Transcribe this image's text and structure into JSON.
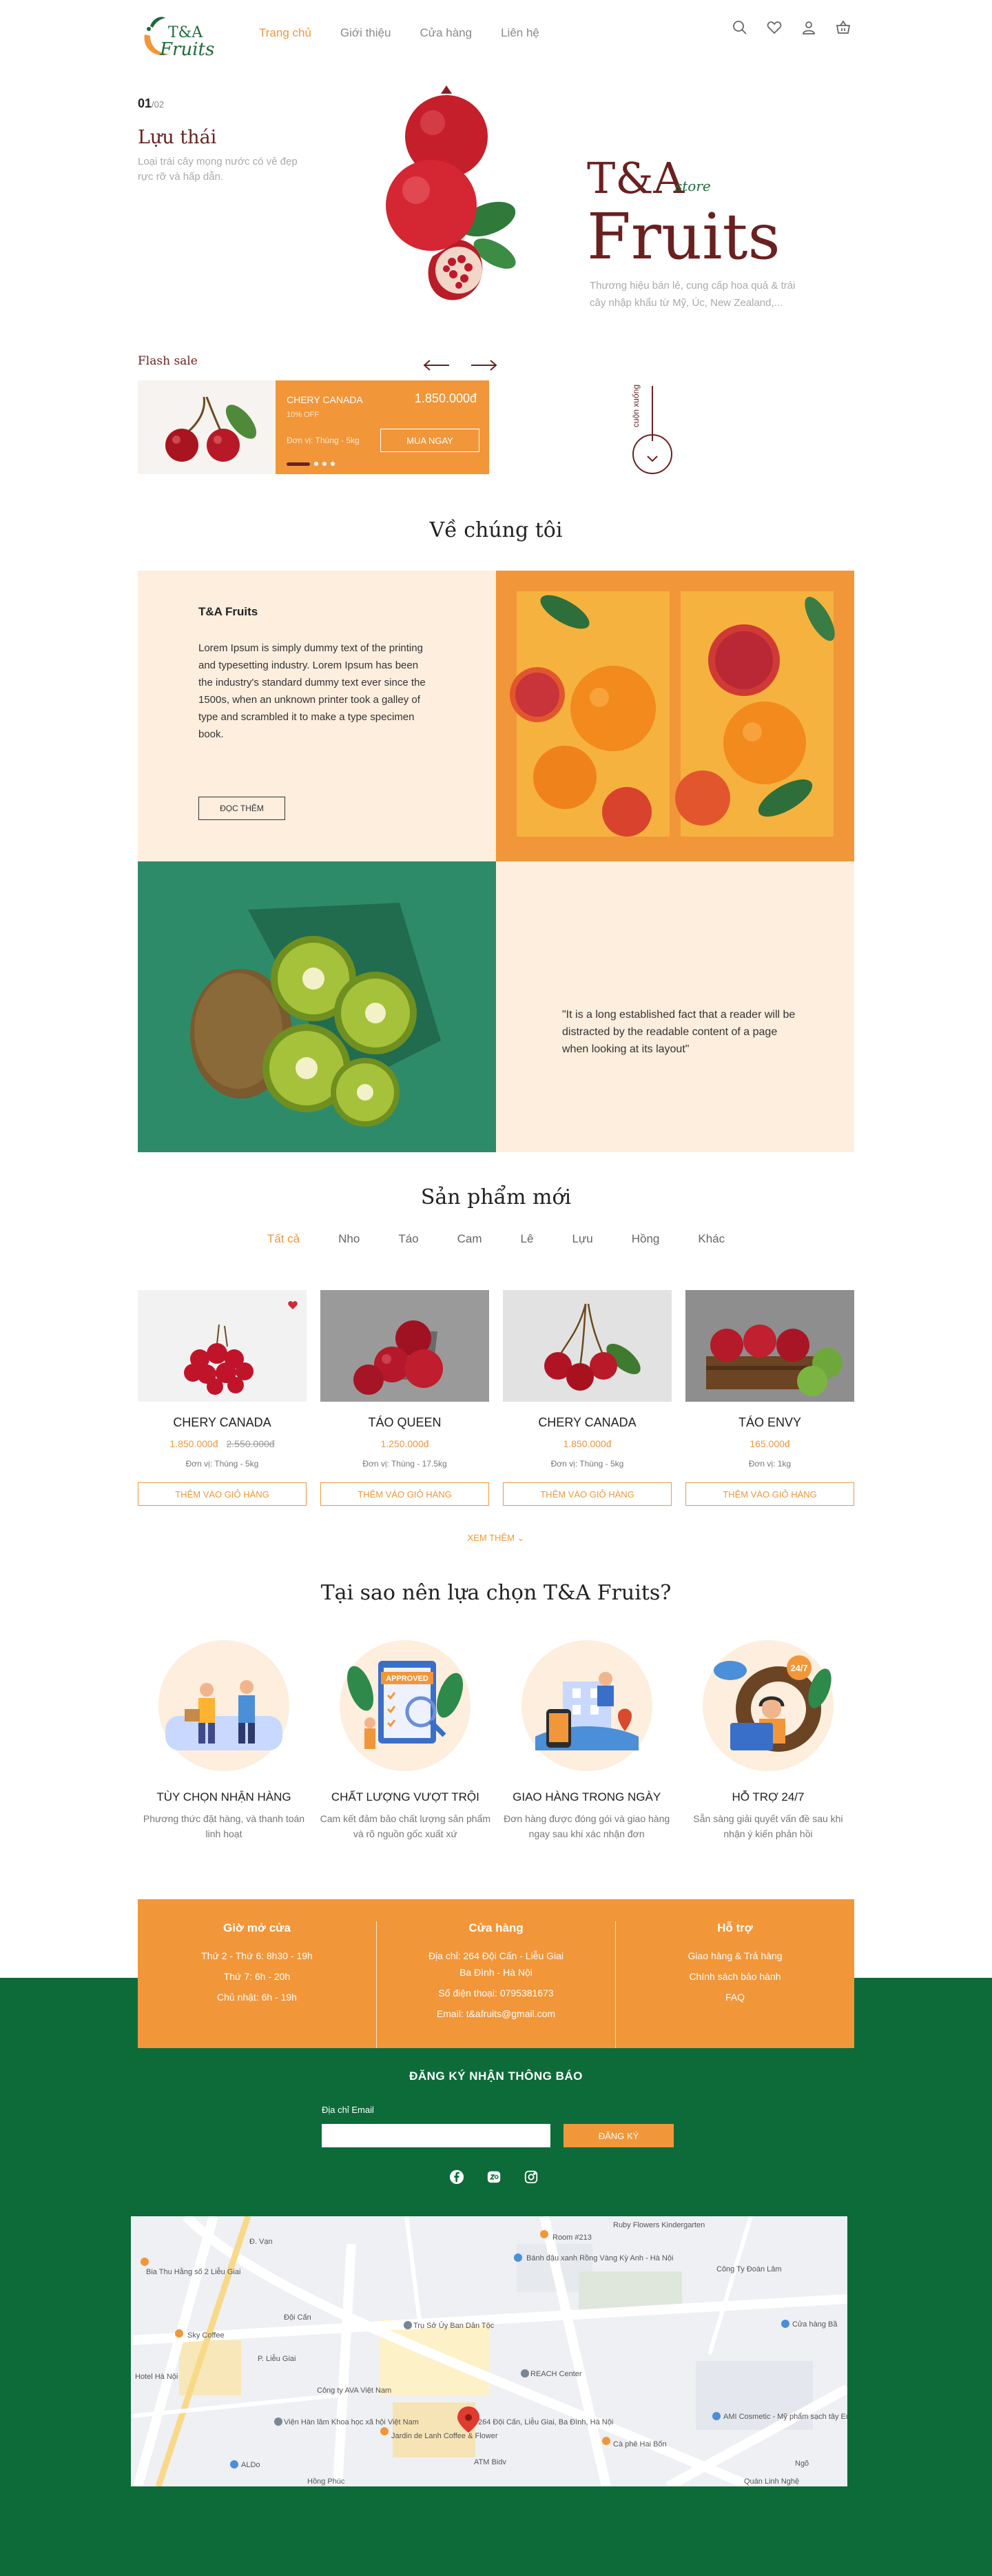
{
  "header": {
    "logo_text_1": "T&A",
    "logo_text_2": "Fruits",
    "nav": [
      "Trang chủ",
      "Giới thiệu",
      "Cửa hàng",
      "Liên hệ"
    ]
  },
  "hero": {
    "slide_current": "01",
    "slide_total": "/02",
    "name": "Lựu thái",
    "desc": "Loại trái cây mọng nước có vẻ đẹp rực rỡ và hấp dẫn.",
    "brand_top": "T&A",
    "brand_store": "store",
    "brand_main": "Fruits",
    "brand_desc": "Thương hiệu bán lẻ, cung cấp hoa quả & trái cây nhập khẩu từ Mỹ, Úc, New Zealand,..."
  },
  "flash": {
    "title": "Flash sale",
    "product": "CHERY CANADA",
    "price": "1.850.000đ",
    "off": "10% OFF",
    "unit": "Đơn vị: Thùng - 5kg",
    "button": "MUA NGAY",
    "scroll": "cuộn xuống"
  },
  "about": {
    "title": "Về chúng tôi",
    "heading": "T&A Fruits",
    "text": "Lorem Ipsum is simply dummy text of the printing and typesetting industry. Lorem Ipsum has been the industry's standard dummy text ever since the 1500s, when an unknown printer took a galley of type and scrambled it to make a type specimen book.",
    "button": "ĐỌC THÊM",
    "quote": "\"It is a long established fact that a reader will be distracted by the readable content of a page when looking at its layout\""
  },
  "products": {
    "title": "Sản phẩm mới",
    "tabs": [
      "Tất cả",
      "Nho",
      "Táo",
      "Cam",
      "Lê",
      "Lựu",
      "Hồng",
      "Khác"
    ],
    "items": [
      {
        "name": "CHERY CANADA",
        "price": "1.850.000đ",
        "old": "2.550.000đ",
        "unit": "Đơn vị: Thùng - 5kg",
        "button": "THÊM VÀO GIỎ HÀNG"
      },
      {
        "name": "TÁO QUEEN",
        "price": "1.250.000đ",
        "old": "",
        "unit": "Đơn vị: Thùng - 17.5kg",
        "button": "THÊM VÀO GIỎ HÀNG"
      },
      {
        "name": "CHERY CANADA",
        "price": "1.850.000đ",
        "old": "",
        "unit": "Đơn vị: Thùng - 5kg",
        "button": "THÊM VÀO GIỎ HÀNG"
      },
      {
        "name": "TÁO ENVY",
        "price": "165.000đ",
        "old": "",
        "unit": "Đơn vị: 1kg",
        "button": "THÊM VÀO GIỎ HÀNG"
      }
    ],
    "more": "XEM THÊM"
  },
  "why": {
    "title": "Tại sao nên lựa chọn T&A Fruits?",
    "items": [
      {
        "title": "TÙY CHỌN NHẬN HÀNG",
        "desc": "Phương thức đặt hàng, và thanh toán linh hoạt"
      },
      {
        "title": "CHẤT LƯỢNG VƯỢT TRỘI",
        "desc": "Cam kết đảm bảo chất lượng sản phẩm và rõ nguồn gốc xuất xứ"
      },
      {
        "title": "GIAO HÀNG TRONG NGÀY",
        "desc": "Đơn hàng được đóng gói và giao hàng ngay sau khi xác nhận đơn"
      },
      {
        "title": "HỖ TRỢ 24/7",
        "desc": "Sẵn sàng giải quyết vấn đề sau khi nhận ý kiến phản hồi"
      }
    ],
    "badge_approved": "APPROVED",
    "badge_247": "24/7"
  },
  "footer": {
    "hours_title": "Giờ mở cửa",
    "hours": [
      "Thứ 2 - Thứ 6: 8h30 - 19h",
      "Thứ 7: 6h - 20h",
      "Chủ nhật: 6h - 19h"
    ],
    "store_title": "Cửa hàng",
    "store": [
      "Địa chỉ: 264 Đội Cấn - Liễu Giai",
      "Ba Đình - Hà Nội",
      "Số điện thoại: 0795381673",
      "Email: t&afruits@gmail.com"
    ],
    "support_title": "Hỗ trợ",
    "support": [
      "Giao hàng & Trả hàng",
      "Chính sách bảo hành",
      "FAQ"
    ],
    "subscribe_title": "ĐĂNG KÝ NHẬN THÔNG BÁO",
    "email_label": "Địa chỉ Email",
    "email_placeholder": "",
    "subscribe_button": "ĐĂNG KÝ"
  },
  "map": {
    "labels": [
      "Ruby Flowers Kindergarten",
      "Room #213",
      "Bánh đậu xanh Rồng Vàng Kỳ Anh - Hà Nội",
      "Công Ty Đoàn Lâm",
      "Bia Thu Hằng số 2 Liễu Giai",
      "Sky Coffee",
      "Trụ Sở Ủy Ban Dân Tộc",
      "Cửa hàng Bầ",
      "Hotel Hà Nội",
      "REACH Center",
      "Công ty AVA Việt Nam",
      "Viện Hàn lâm Khoa học xã hội Việt Nam",
      "Jardin de Lanh Coffee & Flower",
      "264 Đội Cấn, Liễu Giai, Ba Đình, Hà Nội",
      "AMI Cosmetic - Mỹ phẩm sạch tây Eu",
      "Cà phê Hai Bốn",
      "ATM Bidv",
      "ALDo",
      "Hồng Phúc",
      "Quán Linh Nghệ",
      "P. Liễu Giai",
      "Đội Cấn",
      "Đ. Vạn",
      "Ngõ"
    ]
  },
  "colors": {
    "orange": "#f2963a",
    "maroon": "#6b2020",
    "green": "#0d6b3a",
    "cream": "#fdeede"
  }
}
